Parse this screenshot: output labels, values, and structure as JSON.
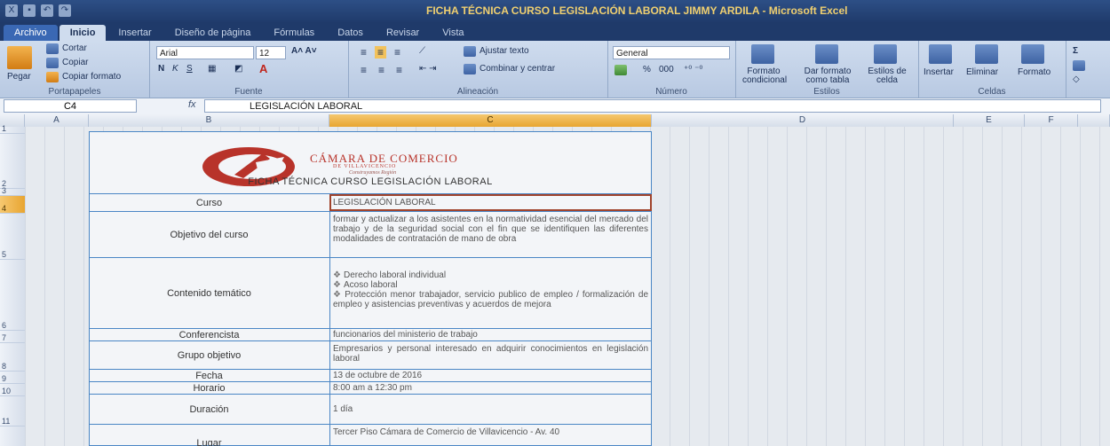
{
  "window": {
    "title": "FICHA TÉCNICA CURSO LEGISLACIÓN LABORAL JIMMY ARDILA - Microsoft Excel"
  },
  "tabs": [
    "Archivo",
    "Inicio",
    "Insertar",
    "Diseño de página",
    "Fórmulas",
    "Datos",
    "Revisar",
    "Vista"
  ],
  "ribbon": {
    "clipboard": {
      "paste": "Pegar",
      "cut": "Cortar",
      "copy": "Copiar",
      "format_painter": "Copiar formato",
      "label": "Portapapeles"
    },
    "font": {
      "name": "Arial",
      "size": "12",
      "label": "Fuente"
    },
    "alignment": {
      "wrap": "Ajustar texto",
      "merge": "Combinar y centrar",
      "label": "Alineación"
    },
    "number": {
      "format": "General",
      "percent": "%",
      "thousands": "000",
      "label": "Número"
    },
    "styles": {
      "conditional": "Formato condicional",
      "as_table": "Dar formato como tabla",
      "cell_styles": "Estilos de celda",
      "label": "Estilos"
    },
    "cells": {
      "insert": "Insertar",
      "delete": "Eliminar",
      "format": "Formato",
      "label": "Celdas"
    }
  },
  "formula_bar": {
    "cell_ref": "C4",
    "fx": "fx",
    "content": "LEGISLACIÓN LABORAL"
  },
  "columns": [
    "A",
    "B",
    "C",
    "D",
    "E",
    "F"
  ],
  "rows": [
    "1",
    "2",
    "3",
    "4",
    "5",
    "6",
    "7",
    "8",
    "9",
    "10",
    "11"
  ],
  "form": {
    "org_name": "CÁMARA DE COMERCIO",
    "org_sub": "DE VILLAVICENCIO",
    "org_tag": "Construyamos Región",
    "title": "FICHA TÉCNICA CURSO LEGISLACIÓN LABORAL",
    "rows": {
      "curso": {
        "label": "Curso",
        "value": "LEGISLACIÓN LABORAL"
      },
      "objetivo": {
        "label": "Objetivo del curso",
        "value": "formar y actualizar a los asistentes en la normatividad esencial del mercado del trabajo y de la seguridad social con el fin que se identifiquen las diferentes modalidades de contratación de mano de obra"
      },
      "contenido": {
        "label": "Contenido temático",
        "bullet": "❖",
        "items": [
          "Derecho laboral individual",
          "Acoso laboral",
          "Protección menor trabajador, servicio publico de empleo / formalización de empleo y asistencias preventivas y acuerdos de mejora"
        ]
      },
      "conferencista": {
        "label": "Conferencista",
        "value": "funcionarios del ministerio de trabajo"
      },
      "grupo": {
        "label": "Grupo objetivo",
        "value": "Empresarios y personal interesado en adquirir conocimientos en legislación laboral"
      },
      "fecha": {
        "label": "Fecha",
        "value": "13 de octubre de 2016"
      },
      "horario": {
        "label": "Horario",
        "value": "8:00 am a 12:30 pm"
      },
      "duracion": {
        "label": "Duración",
        "value": "1 día"
      },
      "lugar": {
        "label": "Lugar",
        "value": "Tercer Piso Cámara de Comercio de Villavicencio - Av. 40"
      }
    }
  }
}
